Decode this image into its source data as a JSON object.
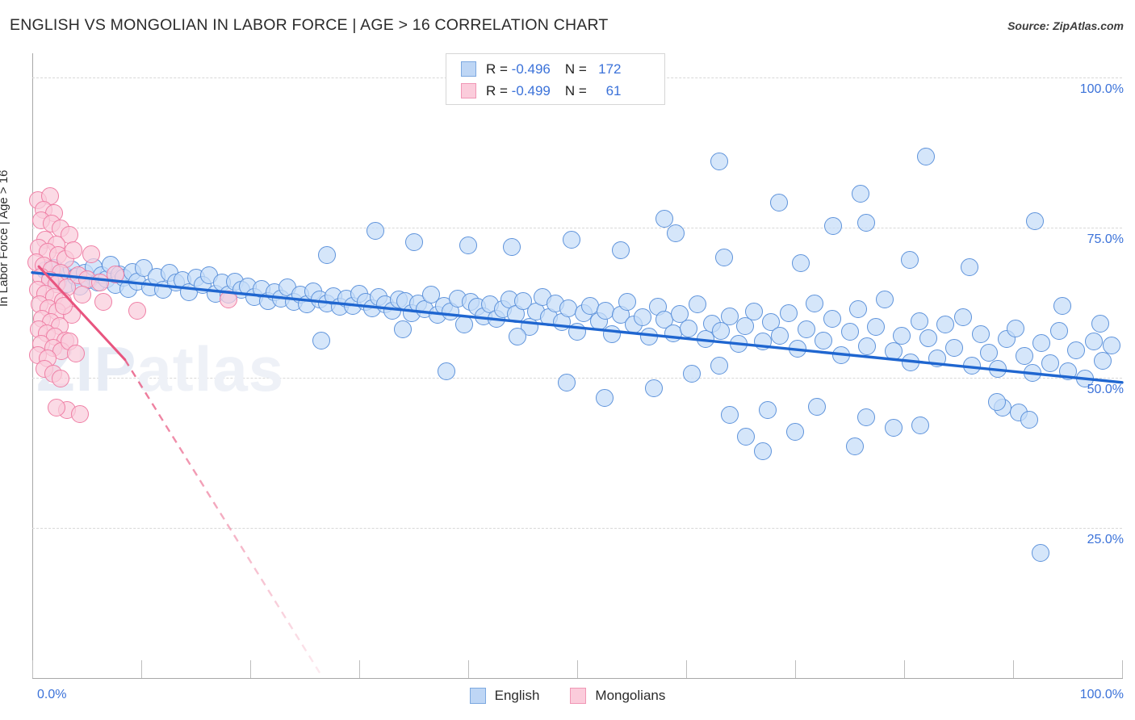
{
  "header": {
    "title": "ENGLISH VS MONGOLIAN IN LABOR FORCE | AGE > 16 CORRELATION CHART",
    "source": "Source: ZipAtlas.com"
  },
  "correlation_legend": {
    "rows": [
      {
        "series": "English",
        "r_label": "R = ",
        "r_value": "-0.496",
        "n_label": "N = ",
        "n_value": "172",
        "color": "#bed6f5"
      },
      {
        "series": "Mongolians",
        "r_label": "R = ",
        "r_value": "-0.499",
        "n_label": "N = ",
        "n_value": "61",
        "color": "#fbccdb"
      }
    ]
  },
  "series_legend": {
    "items": [
      {
        "label": "English",
        "color": "#bed6f5"
      },
      {
        "label": "Mongolians",
        "color": "#fbccdb"
      }
    ]
  },
  "watermark": {
    "text_a": "ZIP",
    "text_b": "atlas"
  },
  "chart_data": {
    "type": "scatter",
    "title": "ENGLISH VS MONGOLIAN IN LABOR FORCE | AGE > 16 CORRELATION CHART",
    "xlabel": "",
    "ylabel": "In Labor Force | Age > 16",
    "xlim": [
      0,
      100
    ],
    "ylim": [
      0,
      104
    ],
    "grid": true,
    "legend_position": "bottom-center",
    "x_ticks": [
      {
        "value": 0,
        "label": "0.0%"
      },
      {
        "value": 100,
        "label": "100.0%"
      }
    ],
    "x_tick_marks": [
      0,
      10,
      20,
      30,
      40,
      50,
      60,
      70,
      80,
      90,
      100
    ],
    "y_ticks": [
      {
        "value": 100,
        "label": "100.0%"
      },
      {
        "value": 75,
        "label": "75.0%"
      },
      {
        "value": 50,
        "label": "50.0%"
      },
      {
        "value": 25,
        "label": "25.0%"
      }
    ],
    "series": [
      {
        "name": "English",
        "color": "#bed6f5",
        "edge_color": "#5e93db",
        "r": -0.496,
        "n": 172,
        "trendline": {
          "x0": 0,
          "y0": 67.5,
          "x1": 100,
          "y1": 49.2,
          "style": "solid",
          "color": "#1f66d0"
        },
        "points": [
          [
            1.2,
            67.8
          ],
          [
            1.6,
            66.5
          ],
          [
            2.0,
            68.2
          ],
          [
            2.4,
            66.0
          ],
          [
            2.8,
            67.3
          ],
          [
            3.2,
            65.6
          ],
          [
            3.6,
            68.0
          ],
          [
            4.0,
            66.8
          ],
          [
            4.4,
            65.2
          ],
          [
            4.8,
            67.5
          ],
          [
            5.2,
            66.2
          ],
          [
            5.6,
            68.4
          ],
          [
            6.0,
            65.8
          ],
          [
            6.4,
            67.0
          ],
          [
            6.8,
            66.4
          ],
          [
            7.2,
            68.8
          ],
          [
            7.6,
            65.4
          ],
          [
            8.0,
            67.2
          ],
          [
            8.4,
            66.6
          ],
          [
            8.8,
            64.8
          ],
          [
            9.2,
            67.6
          ],
          [
            9.6,
            66.0
          ],
          [
            10.2,
            68.2
          ],
          [
            10.8,
            65.0
          ],
          [
            11.4,
            66.8
          ],
          [
            12.0,
            64.6
          ],
          [
            12.6,
            67.4
          ],
          [
            13.2,
            65.8
          ],
          [
            13.8,
            66.2
          ],
          [
            14.4,
            64.2
          ],
          [
            15.0,
            66.6
          ],
          [
            15.6,
            65.4
          ],
          [
            16.2,
            67.0
          ],
          [
            16.8,
            64.0
          ],
          [
            17.4,
            65.8
          ],
          [
            18.0,
            63.8
          ],
          [
            18.6,
            66.0
          ],
          [
            19.2,
            64.6
          ],
          [
            19.8,
            65.2
          ],
          [
            20.4,
            63.4
          ],
          [
            21.0,
            64.8
          ],
          [
            21.6,
            62.8
          ],
          [
            22.2,
            64.2
          ],
          [
            22.8,
            63.2
          ],
          [
            23.4,
            65.0
          ],
          [
            24.0,
            62.6
          ],
          [
            24.6,
            63.8
          ],
          [
            25.2,
            62.2
          ],
          [
            25.8,
            64.4
          ],
          [
            26.4,
            63.0
          ],
          [
            27.0,
            62.4
          ],
          [
            27.6,
            63.6
          ],
          [
            28.2,
            61.8
          ],
          [
            28.8,
            63.2
          ],
          [
            29.4,
            62.0
          ],
          [
            30.0,
            64.0
          ],
          [
            30.6,
            62.6
          ],
          [
            31.2,
            61.6
          ],
          [
            31.8,
            63.4
          ],
          [
            32.4,
            62.2
          ],
          [
            33.0,
            61.2
          ],
          [
            33.6,
            63.0
          ],
          [
            34.2,
            62.8
          ],
          [
            34.8,
            60.8
          ],
          [
            35.4,
            62.4
          ],
          [
            36.0,
            61.4
          ],
          [
            36.6,
            63.8
          ],
          [
            37.2,
            60.4
          ],
          [
            37.8,
            62.0
          ],
          [
            38.4,
            61.0
          ],
          [
            39.0,
            63.2
          ],
          [
            39.6,
            58.8
          ],
          [
            40.2,
            62.6
          ],
          [
            40.8,
            61.8
          ],
          [
            41.4,
            60.2
          ],
          [
            42.0,
            62.2
          ],
          [
            42.6,
            59.8
          ],
          [
            43.2,
            61.4
          ],
          [
            43.8,
            63.0
          ],
          [
            44.4,
            60.6
          ],
          [
            45.0,
            62.8
          ],
          [
            45.6,
            58.4
          ],
          [
            46.2,
            61.0
          ],
          [
            46.8,
            63.4
          ],
          [
            47.4,
            60.0
          ],
          [
            48.0,
            62.4
          ],
          [
            48.6,
            59.2
          ],
          [
            49.2,
            61.6
          ],
          [
            50.0,
            57.6
          ],
          [
            50.6,
            60.8
          ],
          [
            51.2,
            62.0
          ],
          [
            52.0,
            59.4
          ],
          [
            52.6,
            61.2
          ],
          [
            53.2,
            57.2
          ],
          [
            54.0,
            60.4
          ],
          [
            54.6,
            62.6
          ],
          [
            55.2,
            58.8
          ],
          [
            56.0,
            60.0
          ],
          [
            56.6,
            56.8
          ],
          [
            57.4,
            61.8
          ],
          [
            58.0,
            59.6
          ],
          [
            58.8,
            57.4
          ],
          [
            59.4,
            60.6
          ],
          [
            60.2,
            58.2
          ],
          [
            61.0,
            62.2
          ],
          [
            61.8,
            56.4
          ],
          [
            62.4,
            59.0
          ],
          [
            63.2,
            57.8
          ],
          [
            64.0,
            60.2
          ],
          [
            64.8,
            55.6
          ],
          [
            65.4,
            58.6
          ],
          [
            66.2,
            61.0
          ],
          [
            67.0,
            56.0
          ],
          [
            67.8,
            59.2
          ],
          [
            68.6,
            57.0
          ],
          [
            69.4,
            60.8
          ],
          [
            70.2,
            54.8
          ],
          [
            71.0,
            58.0
          ],
          [
            71.8,
            62.4
          ],
          [
            72.6,
            56.2
          ],
          [
            73.4,
            59.8
          ],
          [
            74.2,
            53.8
          ],
          [
            75.0,
            57.6
          ],
          [
            75.8,
            61.4
          ],
          [
            76.6,
            55.2
          ],
          [
            77.4,
            58.4
          ],
          [
            78.2,
            63.0
          ],
          [
            79.0,
            54.4
          ],
          [
            79.8,
            57.0
          ],
          [
            80.6,
            52.6
          ],
          [
            81.4,
            59.4
          ],
          [
            82.2,
            56.6
          ],
          [
            83.0,
            53.2
          ],
          [
            83.8,
            58.8
          ],
          [
            84.6,
            55.0
          ],
          [
            85.4,
            60.0
          ],
          [
            86.2,
            52.0
          ],
          [
            87.0,
            57.2
          ],
          [
            87.8,
            54.2
          ],
          [
            88.6,
            51.4
          ],
          [
            89.4,
            56.4
          ],
          [
            90.2,
            58.2
          ],
          [
            91.0,
            53.6
          ],
          [
            91.8,
            50.8
          ],
          [
            92.6,
            55.8
          ],
          [
            93.4,
            52.4
          ],
          [
            94.2,
            57.8
          ],
          [
            95.0,
            51.0
          ],
          [
            95.8,
            54.6
          ],
          [
            96.6,
            49.8
          ],
          [
            97.4,
            56.0
          ],
          [
            98.2,
            52.8
          ],
          [
            99.0,
            55.4
          ],
          [
            63.0,
            86.0
          ],
          [
            82.0,
            86.8
          ],
          [
            68.5,
            79.2
          ],
          [
            76.0,
            80.6
          ],
          [
            92.0,
            76.0
          ],
          [
            73.5,
            75.2
          ],
          [
            76.5,
            75.8
          ],
          [
            58.0,
            76.4
          ],
          [
            59.0,
            74.0
          ],
          [
            49.5,
            73.0
          ],
          [
            31.5,
            74.4
          ],
          [
            35.0,
            72.6
          ],
          [
            40.0,
            72.0
          ],
          [
            44.0,
            71.8
          ],
          [
            27.0,
            70.4
          ],
          [
            54.0,
            71.2
          ],
          [
            63.5,
            70.0
          ],
          [
            70.5,
            69.0
          ],
          [
            80.5,
            69.6
          ],
          [
            86.0,
            68.4
          ],
          [
            94.5,
            62.0
          ],
          [
            98.0,
            59.0
          ],
          [
            89.0,
            45.0
          ],
          [
            90.5,
            44.2
          ],
          [
            91.5,
            43.0
          ],
          [
            88.5,
            46.0
          ],
          [
            64.0,
            43.8
          ],
          [
            67.5,
            44.6
          ],
          [
            72.0,
            45.2
          ],
          [
            76.5,
            43.4
          ],
          [
            65.5,
            40.2
          ],
          [
            70.0,
            41.0
          ],
          [
            81.5,
            42.0
          ],
          [
            79.0,
            41.6
          ],
          [
            67.0,
            37.8
          ],
          [
            75.5,
            38.6
          ],
          [
            92.5,
            20.8
          ],
          [
            38.0,
            51.0
          ],
          [
            49.0,
            49.2
          ],
          [
            57.0,
            48.2
          ],
          [
            60.5,
            50.6
          ],
          [
            63.0,
            52.0
          ],
          [
            52.5,
            46.6
          ],
          [
            44.5,
            56.8
          ],
          [
            34.0,
            58.0
          ],
          [
            26.5,
            56.2
          ]
        ]
      },
      {
        "name": "Mongolians",
        "color": "#fbccdb",
        "edge_color": "#ef7fa5",
        "r": -0.499,
        "n": 61,
        "trendline": {
          "x0": 0.6,
          "y0": 68.5,
          "x1": 8.5,
          "y1": 53.0,
          "style": "solid",
          "color": "#e8557f",
          "dash_x0": 8.5,
          "dash_y0": 53.0,
          "dash_x1": 26.5,
          "dash_y1": 0.5
        },
        "points": [
          [
            0.5,
            79.6
          ],
          [
            1.6,
            80.2
          ],
          [
            1.0,
            78.0
          ],
          [
            2.0,
            77.4
          ],
          [
            0.8,
            76.2
          ],
          [
            1.8,
            75.6
          ],
          [
            2.6,
            74.8
          ],
          [
            3.4,
            73.8
          ],
          [
            1.2,
            73.0
          ],
          [
            2.2,
            72.2
          ],
          [
            0.6,
            71.6
          ],
          [
            1.4,
            71.0
          ],
          [
            2.4,
            70.4
          ],
          [
            3.0,
            69.8
          ],
          [
            0.4,
            69.2
          ],
          [
            1.0,
            68.6
          ],
          [
            1.8,
            68.0
          ],
          [
            2.6,
            67.4
          ],
          [
            0.8,
            66.8
          ],
          [
            1.6,
            66.2
          ],
          [
            2.2,
            65.6
          ],
          [
            3.2,
            65.0
          ],
          [
            0.5,
            64.6
          ],
          [
            1.2,
            64.0
          ],
          [
            2.0,
            63.4
          ],
          [
            2.8,
            62.8
          ],
          [
            0.7,
            62.2
          ],
          [
            1.5,
            61.6
          ],
          [
            2.3,
            61.0
          ],
          [
            3.6,
            60.4
          ],
          [
            0.9,
            59.8
          ],
          [
            1.7,
            59.2
          ],
          [
            2.5,
            58.6
          ],
          [
            0.6,
            58.0
          ],
          [
            1.3,
            57.4
          ],
          [
            2.1,
            56.8
          ],
          [
            3.0,
            56.2
          ],
          [
            0.8,
            55.6
          ],
          [
            1.9,
            55.0
          ],
          [
            2.7,
            54.4
          ],
          [
            0.5,
            53.8
          ],
          [
            1.4,
            53.2
          ],
          [
            2.9,
            62.0
          ],
          [
            4.2,
            67.0
          ],
          [
            5.0,
            66.4
          ],
          [
            6.2,
            65.8
          ],
          [
            7.6,
            67.2
          ],
          [
            4.6,
            63.8
          ],
          [
            3.8,
            71.2
          ],
          [
            5.4,
            70.6
          ],
          [
            1.1,
            51.4
          ],
          [
            1.9,
            50.6
          ],
          [
            2.6,
            49.8
          ],
          [
            3.4,
            56.0
          ],
          [
            4.0,
            54.0
          ],
          [
            3.2,
            44.6
          ],
          [
            4.4,
            44.0
          ],
          [
            9.6,
            61.2
          ],
          [
            18.0,
            63.0
          ],
          [
            2.2,
            45.0
          ],
          [
            6.5,
            62.6
          ]
        ]
      }
    ]
  }
}
